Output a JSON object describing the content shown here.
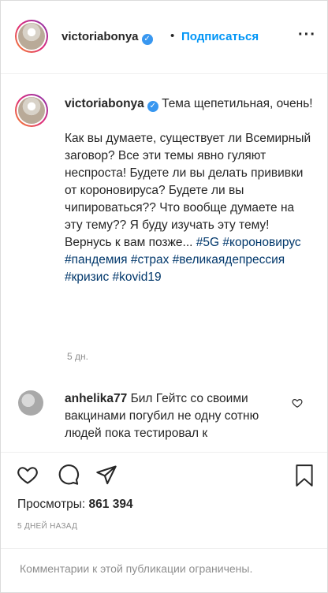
{
  "header": {
    "username": "victoriabonya",
    "separator": "•",
    "follow_label": "Подписаться",
    "more_label": "···"
  },
  "caption": {
    "username": "victoriabonya",
    "line1": "Тема щепетильная, очень!",
    "body": "Как вы думаете, существует ли Всемирный заговор? Все эти темы явно гуляют неспроста! Будете ли вы делать прививки от короновируса? Будете ли вы чипироваться?? Что вообще думаете на эту тему?? Я буду изучать эту тему! Вернусь к вам позже...",
    "hashtags": [
      "#5G",
      "#короновирус",
      "#пандемия",
      "#страх",
      "#великаядепрессия",
      "#кризис",
      "#kovid19"
    ],
    "time": "5 дн."
  },
  "comment": {
    "username": "anhelika77",
    "text": "Бил Гейтс со своими вакцинами погубил не одну сотню людей пока тестировал к"
  },
  "views": {
    "label": "Просмотры:",
    "value": "861 394"
  },
  "date": "5 ДНЕЙ НАЗАД",
  "footer": {
    "text": "Комментарии к этой публикации ограничены."
  },
  "colors": {
    "link": "#0095f6",
    "hashtag": "#00376b",
    "muted": "#8e8e8e",
    "verified": "#3897f0"
  }
}
